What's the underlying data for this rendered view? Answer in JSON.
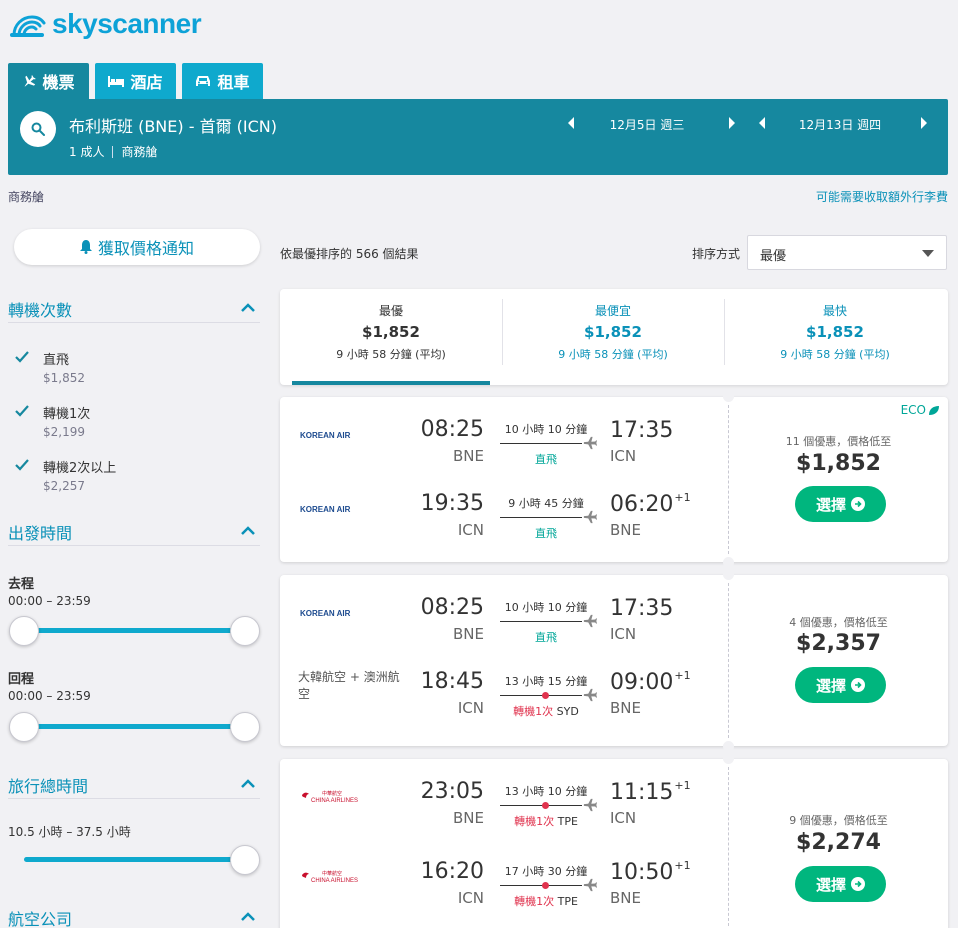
{
  "brand": {
    "name": "skyscanner",
    "color": "#0da2d7"
  },
  "tabs": [
    {
      "label": "機票",
      "icon": "plane-icon",
      "active": true
    },
    {
      "label": "酒店",
      "icon": "bed-icon"
    },
    {
      "label": "租車",
      "icon": "car-icon"
    }
  ],
  "search": {
    "route": "布利斯班 (BNE) - 首爾 (ICN)",
    "passengers": "1 成人",
    "cabin": "商務艙",
    "depart_date": "12月5日 週三",
    "return_date": "12月13日 週四"
  },
  "cabin_label": "商務艙",
  "baggage_link": "可能需要收取額外行李費",
  "price_alert_label": "獲取價格通知",
  "filters": {
    "stops": {
      "title": "轉機次數",
      "options": [
        {
          "label": "直飛",
          "price": "$1,852",
          "checked": true
        },
        {
          "label": "轉機1次",
          "price": "$2,199",
          "checked": true
        },
        {
          "label": "轉機2次以上",
          "price": "$2,257",
          "checked": true
        }
      ]
    },
    "departure_times": {
      "title": "出發時間",
      "outbound_label": "去程",
      "outbound_range": "00:00 – 23:59",
      "return_label": "回程",
      "return_range": "00:00 – 23:59"
    },
    "journey_duration": {
      "title": "旅行總時間",
      "range": "10.5 小時 – 37.5 小時"
    },
    "airlines": {
      "title": "航空公司"
    }
  },
  "results": {
    "count_text": "依最優排序的 566 個結果",
    "sort_label": "排序方式",
    "sort_value": "最優"
  },
  "sort_tabs": [
    {
      "title": "最優",
      "price": "$1,852",
      "duration": "9 小時 58 分鐘 (平均)",
      "active": true
    },
    {
      "title": "最便宜",
      "price": "$1,852",
      "duration": "9 小時 58 分鐘 (平均)"
    },
    {
      "title": "最快",
      "price": "$1,852",
      "duration": "9 小時 58 分鐘 (平均)"
    }
  ],
  "cards": [
    {
      "eco": "ECO",
      "deals": "11 個優惠，價格低至",
      "price": "$1,852",
      "select_label": "選擇",
      "legs": [
        {
          "airline_logo": "KOREAN AIR",
          "dep_time": "08:25",
          "dep_airport": "BNE",
          "duration": "10 小時 10 分鐘",
          "stops": "直飛",
          "arr_time": "17:35",
          "arr_airport": "ICN",
          "plus": ""
        },
        {
          "airline_logo": "KOREAN AIR",
          "dep_time": "19:35",
          "dep_airport": "ICN",
          "duration": "9 小時 45 分鐘",
          "stops": "直飛",
          "arr_time": "06:20",
          "arr_airport": "BNE",
          "plus": "+1"
        }
      ]
    },
    {
      "deals": "4 個優惠，價格低至",
      "price": "$2,357",
      "select_label": "選擇",
      "legs": [
        {
          "airline_logo": "KOREAN AIR",
          "dep_time": "08:25",
          "dep_airport": "BNE",
          "duration": "10 小時 10 分鐘",
          "stops": "直飛",
          "arr_time": "17:35",
          "arr_airport": "ICN",
          "plus": ""
        },
        {
          "airline_text": "大韓航空 + 澳洲航空",
          "dep_time": "18:45",
          "dep_airport": "ICN",
          "duration": "13 小時 15 分鐘",
          "stops": "轉機1次",
          "stop_code": "SYD",
          "arr_time": "09:00",
          "arr_airport": "BNE",
          "plus": "+1"
        }
      ]
    },
    {
      "deals": "9 個優惠，價格低至",
      "price": "$2,274",
      "select_label": "選擇",
      "legs": [
        {
          "airline_logo": "CHINA AIRLINES",
          "airline_logo_cn": "中華航空",
          "dep_time": "23:05",
          "dep_airport": "BNE",
          "duration": "13 小時 10 分鐘",
          "stops": "轉機1次",
          "stop_code": "TPE",
          "arr_time": "11:15",
          "arr_airport": "ICN",
          "plus": "+1"
        },
        {
          "airline_logo": "CHINA AIRLINES",
          "airline_logo_cn": "中華航空",
          "dep_time": "16:20",
          "dep_airport": "ICN",
          "duration": "17 小時 30 分鐘",
          "stops": "轉機1次",
          "stop_code": "TPE",
          "arr_time": "10:50",
          "arr_airport": "BNE",
          "plus": "+1"
        }
      ]
    }
  ],
  "colors": {
    "teal_header": "#16889f",
    "tab": "#0fa9cd",
    "link": "#0a91b8",
    "direct": "#00a698",
    "stop_red": "#e0334e",
    "select_green": "#00b67e",
    "korean_air_blue": "#1d4b8f",
    "china_airlines_red": "#c8102e"
  }
}
